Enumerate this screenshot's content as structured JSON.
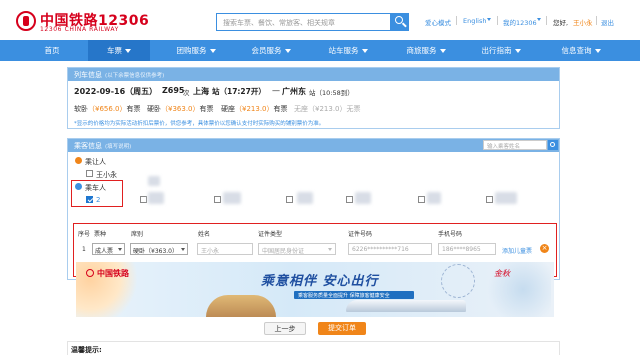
{
  "header": {
    "logo_title": "中国铁路12306",
    "logo_sub": "12306 CHINA RAILWAY",
    "search_placeholder": "搜索车票、餐饮、常旅客、相关规章",
    "links": [
      "爱心模式",
      "English",
      "我的12306"
    ],
    "greeting": "您好,",
    "user": "王小永",
    "logout": "退出"
  },
  "nav": [
    {
      "label": "首页",
      "caret": false
    },
    {
      "label": "车票",
      "caret": true
    },
    {
      "label": "团购服务",
      "caret": true
    },
    {
      "label": "会员服务",
      "caret": true
    },
    {
      "label": "站车服务",
      "caret": true
    },
    {
      "label": "商旅服务",
      "caret": true
    },
    {
      "label": "出行指南",
      "caret": true
    },
    {
      "label": "信息查询",
      "caret": true
    }
  ],
  "train_info": {
    "head": "列车信息",
    "head_note": "(以下余票信息仅供参考)",
    "date": "2022-09-16（周五）",
    "train_no": "Z695",
    "train_suffix": "次",
    "from": "上海",
    "from_suffix": "站（17:27开）",
    "arrow": "—",
    "to": "广州东",
    "to_suffix": "站（10:58到）",
    "seats": [
      {
        "name": "软卧",
        "price": "（¥656.0）",
        "status": "有票"
      },
      {
        "name": "硬卧",
        "price": "（¥363.0）",
        "status": "有票"
      },
      {
        "name": "硬座",
        "price": "（¥213.0）",
        "status": "有票"
      },
      {
        "name": "无座",
        "price": "（¥213.0）",
        "status": "无票"
      }
    ],
    "note": "*显示的价格均为实际活动折扣后票价，供您参考，具体票价以您确认支付时实际购买的铺别票价为准。"
  },
  "passengers": {
    "head": "乘客信息",
    "head_note": "(填写说明)",
    "search_placeholder": "输入乘客姓名",
    "traveler_label": "乘让人",
    "traveler_name": "王小永",
    "group_label": "乘车人",
    "checked_name": "2"
  },
  "table": {
    "headers": [
      "序号",
      "票种",
      "席别",
      "姓名",
      "证件类型",
      "证件号码",
      "手机号码"
    ],
    "row": {
      "index": "1",
      "ticket_type": "成人票",
      "seat": "硬卧（¥363.0）",
      "name": "王小永",
      "id_type": "中国居民身份证",
      "id_no": "6226**********716",
      "phone": "186****8965",
      "add_child": "添加儿童票"
    }
  },
  "banner": {
    "brand": "中国铁路",
    "slogan": "乘意相伴 安心出行",
    "sub": "乘客服务质量全面提升 保障旅客健康安全",
    "stamp": "金秋"
  },
  "actions": {
    "prev": "上一步",
    "submit": "提交订单"
  },
  "tips": {
    "title": "温馨提示:"
  },
  "colors": {
    "brand_red": "#d6001c",
    "nav_blue": "#3b8fe0",
    "orange": "#f08519"
  }
}
